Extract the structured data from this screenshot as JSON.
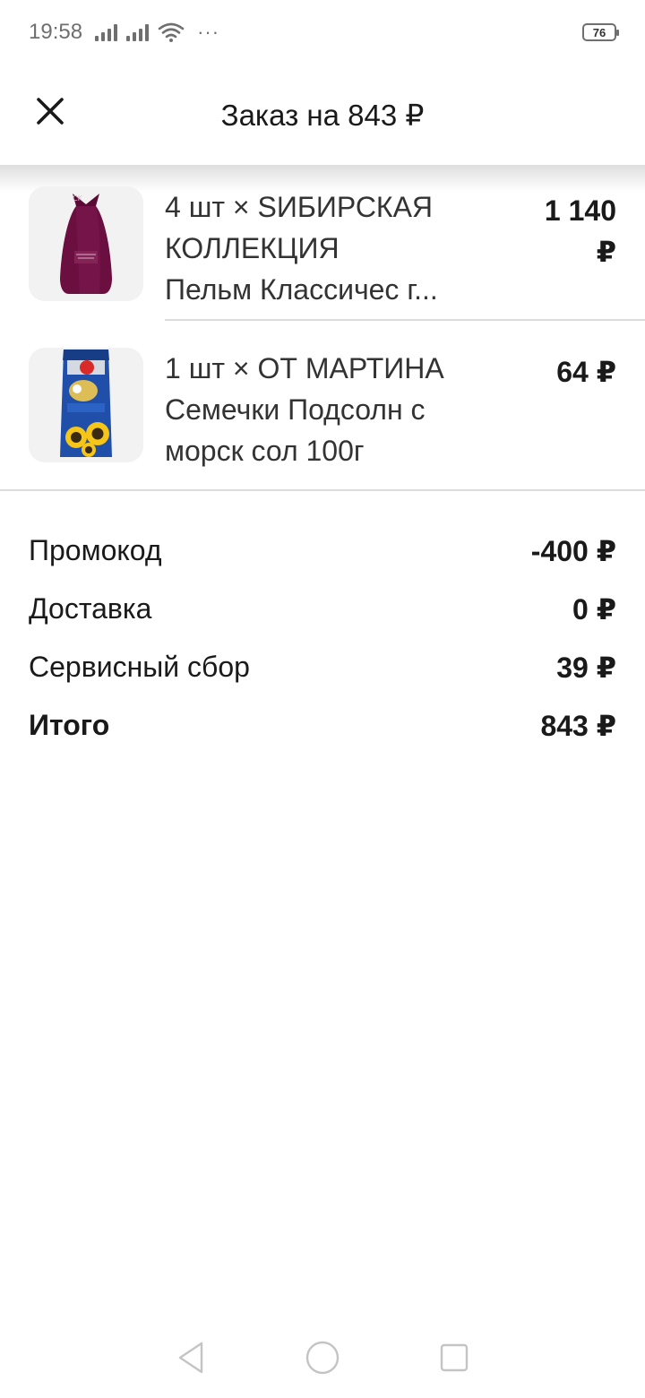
{
  "status_bar": {
    "time": "19:58",
    "battery": "76",
    "more": "···"
  },
  "header": {
    "title": "Заказ на 843 ₽",
    "close_icon": "close-icon"
  },
  "items": [
    {
      "line1": "4 шт × SИБИРСКАЯ",
      "line2": "КОЛЛЕКЦИЯ",
      "line3": "Пельм Классичес г...",
      "price_line1": "1 140",
      "price_line2": "₽",
      "image": "dumplings-package-image"
    },
    {
      "line1": "1 шт × ОТ МАРТИНА",
      "line2": "Семечки Подсолн с",
      "line3": "морск сол 100г",
      "price": "64 ₽",
      "image": "sunflower-seeds-package-image"
    }
  ],
  "summary": {
    "promo_label": "Промокод",
    "promo_value": "-400 ₽",
    "delivery_label": "Доставка",
    "delivery_value": "0 ₽",
    "service_label": "Сервисный сбор",
    "service_value": "39 ₽",
    "total_label": "Итого",
    "total_value": "843 ₽"
  },
  "navbar": {
    "icons": [
      "back-icon",
      "home-icon",
      "recents-icon"
    ]
  }
}
